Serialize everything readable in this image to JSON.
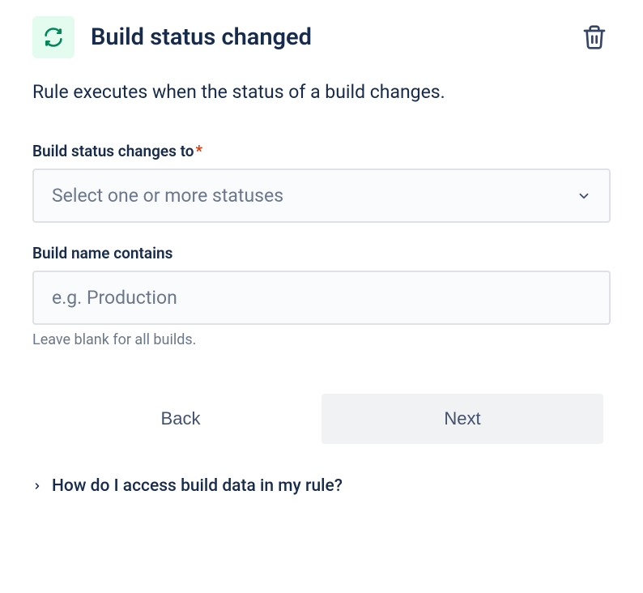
{
  "header": {
    "title": "Build status changed"
  },
  "description": "Rule executes when the status of a build changes.",
  "fields": {
    "status": {
      "label": "Build status changes to",
      "placeholder": "Select one or more statuses"
    },
    "buildName": {
      "label": "Build name contains",
      "placeholder": "e.g. Production",
      "helper": "Leave blank for all builds."
    }
  },
  "buttons": {
    "back": "Back",
    "next": "Next"
  },
  "help": {
    "linkText": "How do I access build data in my rule?"
  },
  "colors": {
    "iconBadge": "#e3fcef",
    "iconArrows": "#00875a",
    "requiredAsterisk": "#de350b"
  }
}
